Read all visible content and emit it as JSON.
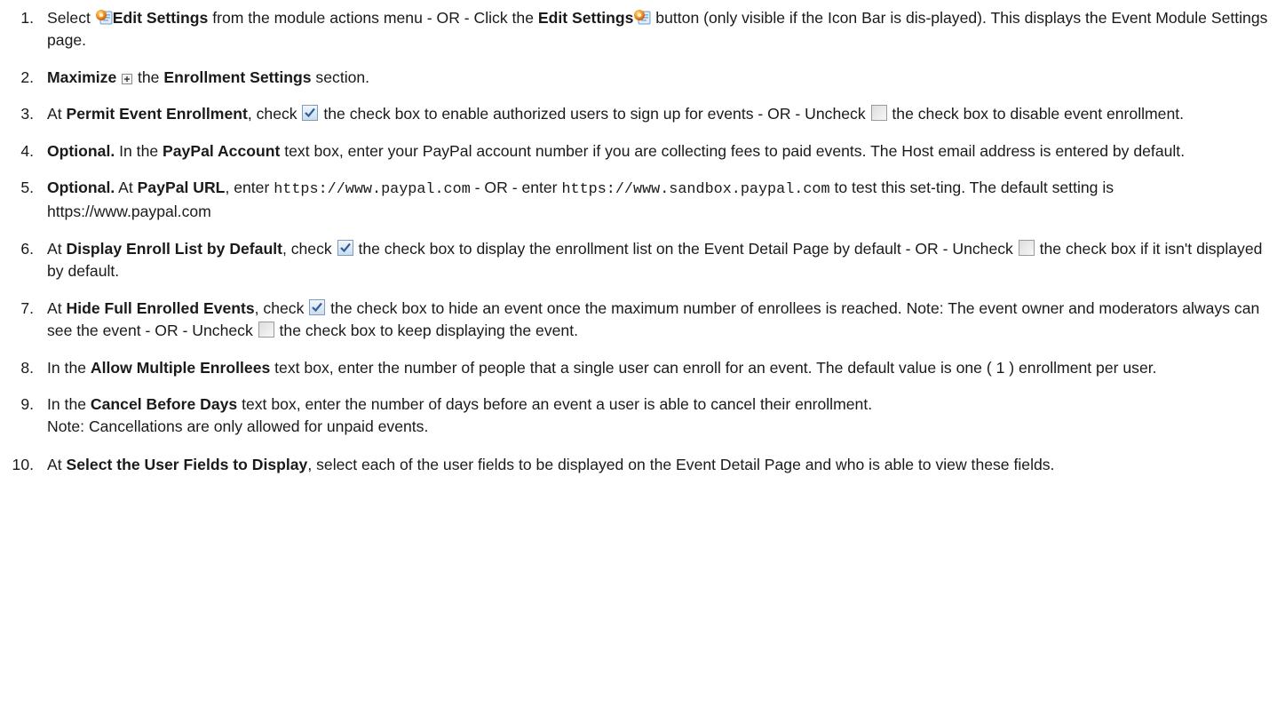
{
  "steps": [
    {
      "n": "1.",
      "parts": [
        {
          "t": "text",
          "v": "Select "
        },
        {
          "t": "icon",
          "icon": "edit-settings-icon"
        },
        {
          "t": "bold",
          "v": "Edit Settings"
        },
        {
          "t": "text",
          "v": " from the module actions menu - OR - Click the "
        },
        {
          "t": "bold",
          "v": "Edit Settings"
        },
        {
          "t": "icon",
          "icon": "edit-settings-icon"
        },
        {
          "t": "text",
          "v": " button (only visible if the Icon Bar is dis-played). This displays the Event Module Settings page."
        }
      ]
    },
    {
      "n": "2.",
      "parts": [
        {
          "t": "bold",
          "v": "Maximize "
        },
        {
          "t": "icon",
          "icon": "maximize-icon"
        },
        {
          "t": "text",
          "v": " the "
        },
        {
          "t": "bold",
          "v": "Enrollment Settings"
        },
        {
          "t": "text",
          "v": " section."
        }
      ]
    },
    {
      "n": "3.",
      "parts": [
        {
          "t": "text",
          "v": "At "
        },
        {
          "t": "bold",
          "v": "Permit Event Enrollment"
        },
        {
          "t": "text",
          "v": ", check "
        },
        {
          "t": "icon",
          "icon": "checkbox-checked-icon"
        },
        {
          "t": "text",
          "v": " the check box to enable authorized users to sign up for events - OR - Uncheck "
        },
        {
          "t": "icon",
          "icon": "checkbox-unchecked-icon"
        },
        {
          "t": "text",
          "v": " the check box to disable event enrollment."
        }
      ]
    },
    {
      "n": "4.",
      "parts": [
        {
          "t": "bold",
          "v": "Optional."
        },
        {
          "t": "text",
          "v": " In the "
        },
        {
          "t": "bold",
          "v": "PayPal Account"
        },
        {
          "t": "text",
          "v": " text box, enter your PayPal account number if you are collecting fees to paid events. The Host email address is entered by default."
        }
      ]
    },
    {
      "n": "5.",
      "parts": [
        {
          "t": "bold",
          "v": "Optional."
        },
        {
          "t": "text",
          "v": " At "
        },
        {
          "t": "bold",
          "v": "PayPal URL"
        },
        {
          "t": "text",
          "v": ", enter "
        },
        {
          "t": "mono",
          "v": "https://www.paypal.com"
        },
        {
          "t": "text",
          "v": " - OR - enter "
        },
        {
          "t": "mono",
          "v": "https://www.sandbox.paypal.com"
        },
        {
          "t": "text",
          "v": " to test this set-ting. The default setting is https://www.paypal.com"
        }
      ]
    },
    {
      "n": "6.",
      "parts": [
        {
          "t": "text",
          "v": "At "
        },
        {
          "t": "bold",
          "v": "Display Enroll List by Default"
        },
        {
          "t": "text",
          "v": ", check "
        },
        {
          "t": "icon",
          "icon": "checkbox-checked-icon"
        },
        {
          "t": "text",
          "v": " the check box to display the enrollment list on the Event Detail Page by default - OR - Uncheck "
        },
        {
          "t": "icon",
          "icon": "checkbox-unchecked-icon"
        },
        {
          "t": "text",
          "v": " the check box if it isn't displayed by default."
        }
      ]
    },
    {
      "n": "7.",
      "parts": [
        {
          "t": "text",
          "v": "At "
        },
        {
          "t": "bold",
          "v": "Hide Full Enrolled Events"
        },
        {
          "t": "text",
          "v": ", check "
        },
        {
          "t": "icon",
          "icon": "checkbox-checked-icon"
        },
        {
          "t": "text",
          "v": " the check box to hide an event once the maximum number of enrollees is reached. Note: The event owner and moderators always can see the event - OR - Uncheck "
        },
        {
          "t": "icon",
          "icon": "checkbox-unchecked-icon"
        },
        {
          "t": "text",
          "v": " the check box to keep displaying the event."
        }
      ]
    },
    {
      "n": "8.",
      "parts": [
        {
          "t": "text",
          "v": "In the "
        },
        {
          "t": "bold",
          "v": "Allow Multiple Enrollees"
        },
        {
          "t": "text",
          "v": " text box, enter the number of people that a single user can enroll for an event. The default value is one ( 1 ) enrollment per user."
        }
      ]
    },
    {
      "n": "9.",
      "parts": [
        {
          "t": "text",
          "v": "In the "
        },
        {
          "t": "bold",
          "v": "Cancel Before Days"
        },
        {
          "t": "text",
          "v": " text box, enter the number of days before an event a user is able to cancel their enrollment."
        },
        {
          "t": "br"
        },
        {
          "t": "text",
          "v": "Note: Cancellations are only allowed for unpaid events."
        }
      ]
    },
    {
      "n": "10.",
      "parts": [
        {
          "t": "text",
          "v": "At "
        },
        {
          "t": "bold",
          "v": "Select the User Fields to Display"
        },
        {
          "t": "text",
          "v": ", select each of the user fields to be displayed on the Event Detail Page and who is able to view these fields."
        }
      ]
    }
  ]
}
